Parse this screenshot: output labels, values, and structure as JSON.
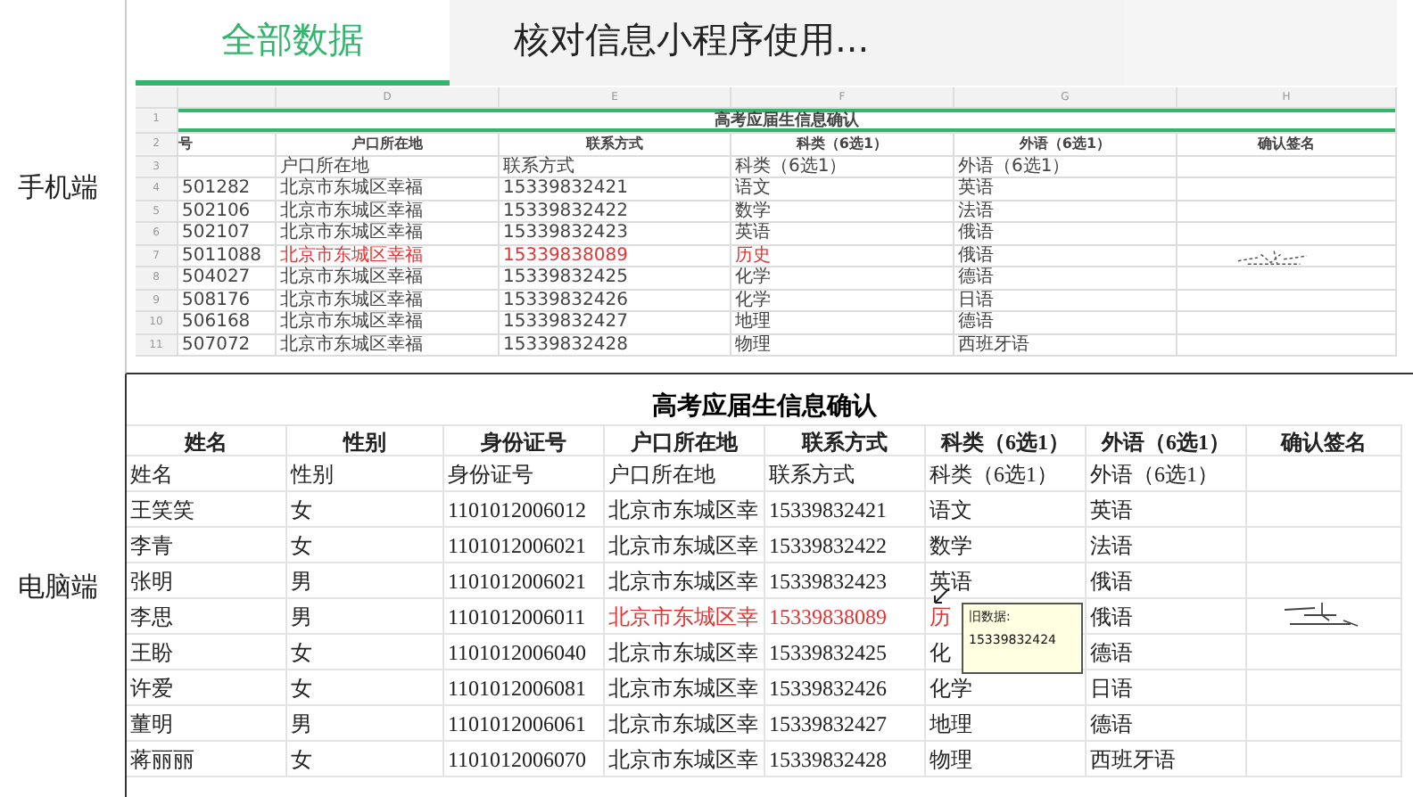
{
  "mobile": {
    "label": "手机端",
    "tabs": [
      {
        "label": "全部数据",
        "selected": true
      },
      {
        "label": "核对信息小程序使用...",
        "selected": false
      }
    ],
    "sheet": {
      "column_letters": [
        "D",
        "E",
        "F",
        "G",
        "H"
      ],
      "row_numbers": [
        "1",
        "2",
        "3",
        "4",
        "5",
        "6",
        "7",
        "8",
        "9",
        "10",
        "11"
      ],
      "title": "高考应届生信息确认",
      "header": [
        "号",
        "户口所在地",
        "联系方式",
        "科类（6选1）",
        "外语（6选1）",
        "确认签名"
      ],
      "rows": [
        {
          "cells": [
            "",
            "户口所在地",
            "联系方式",
            "科类（6选1）",
            "外语（6选1）"
          ],
          "highlighted": false,
          "signed": false
        },
        {
          "cells": [
            "501282",
            "北京市东城区幸福",
            "15339832421",
            "语文",
            "英语"
          ],
          "highlighted": false,
          "signed": false
        },
        {
          "cells": [
            "502106",
            "北京市东城区幸福",
            "15339832422",
            "数学",
            "法语"
          ],
          "highlighted": false,
          "signed": false
        },
        {
          "cells": [
            "502107",
            "北京市东城区幸福",
            "15339832423",
            "英语",
            "俄语"
          ],
          "highlighted": false,
          "signed": false
        },
        {
          "cells": [
            "5011088",
            "北京市东城区幸福",
            "15339838089",
            "历史",
            "俄语"
          ],
          "highlighted": true,
          "signed": true
        },
        {
          "cells": [
            "504027",
            "北京市东城区幸福",
            "15339832425",
            "化学",
            "德语"
          ],
          "highlighted": false,
          "signed": false
        },
        {
          "cells": [
            "508176",
            "北京市东城区幸福",
            "15339832426",
            "化学",
            "日语"
          ],
          "highlighted": false,
          "signed": false
        },
        {
          "cells": [
            "506168",
            "北京市东城区幸福",
            "15339832427",
            "地理",
            "德语"
          ],
          "highlighted": false,
          "signed": false
        },
        {
          "cells": [
            "507072",
            "北京市东城区幸福",
            "15339832428",
            "物理",
            "西班牙语"
          ],
          "highlighted": false,
          "signed": false
        }
      ]
    }
  },
  "desktop": {
    "label": "电脑端",
    "title": "高考应届生信息确认",
    "header": [
      "姓名",
      "性别",
      "身份证号",
      "户口所在地",
      "联系方式",
      "科类（6选1）",
      "外语（6选1）",
      "确认签名"
    ],
    "rows": [
      {
        "cells": [
          "姓名",
          "性别",
          "身份证号",
          "户口所在地",
          "联系方式",
          "科类（6选1）",
          "外语（6选1）"
        ],
        "highlighted": false,
        "signed": false
      },
      {
        "cells": [
          "王笑笑",
          "女",
          "1101012006012",
          "北京市东城区幸",
          "15339832421",
          "语文",
          "英语"
        ],
        "highlighted": false,
        "signed": false
      },
      {
        "cells": [
          "李青",
          "女",
          "1101012006021",
          "北京市东城区幸",
          "15339832422",
          "数学",
          "法语"
        ],
        "highlighted": false,
        "signed": false
      },
      {
        "cells": [
          "张明",
          "男",
          "1101012006021",
          "北京市东城区幸",
          "15339832423",
          "英语",
          "俄语"
        ],
        "highlighted": false,
        "signed": false
      },
      {
        "cells": [
          "李思",
          "男",
          "1101012006011",
          "北京市东城区幸",
          "15339838089",
          "历",
          "俄语"
        ],
        "highlighted": true,
        "signed": true
      },
      {
        "cells": [
          "王盼",
          "女",
          "1101012006040",
          "北京市东城区幸",
          "15339832425",
          "化",
          "德语"
        ],
        "highlighted": false,
        "signed": false
      },
      {
        "cells": [
          "许爱",
          "女",
          "1101012006081",
          "北京市东城区幸",
          "15339832426",
          "化学",
          "日语"
        ],
        "highlighted": false,
        "signed": false
      },
      {
        "cells": [
          "董明",
          "男",
          "1101012006061",
          "北京市东城区幸",
          "15339832427",
          "地理",
          "德语"
        ],
        "highlighted": false,
        "signed": false
      },
      {
        "cells": [
          "蒋丽丽",
          "女",
          "1101012006070",
          "北京市东城区幸",
          "15339832428",
          "物理",
          "西班牙语"
        ],
        "highlighted": false,
        "signed": false
      }
    ],
    "comment": {
      "title": "旧数据:",
      "text": "15339832424"
    }
  }
}
